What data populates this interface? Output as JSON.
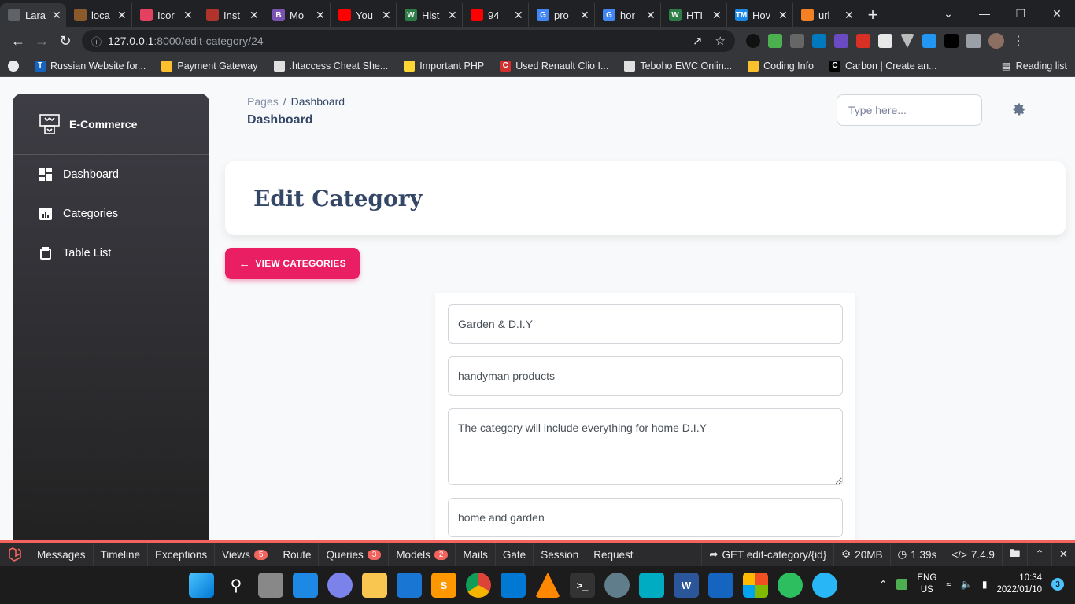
{
  "browser": {
    "tabs": [
      {
        "title": "Lara",
        "color": "#5f6368",
        "glyph": "",
        "active": true
      },
      {
        "title": "loca",
        "color": "#8b5a2b",
        "glyph": ""
      },
      {
        "title": "Icor",
        "color": "#e4405f",
        "glyph": ""
      },
      {
        "title": "Inst",
        "color": "#b0342b",
        "glyph": ""
      },
      {
        "title": "Mo",
        "color": "#7952b3",
        "glyph": "B"
      },
      {
        "title": "You",
        "color": "#ff0000",
        "glyph": ""
      },
      {
        "title": "Hist",
        "color": "#2d7d46",
        "glyph": "W"
      },
      {
        "title": "94",
        "color": "#ff0000",
        "glyph": ""
      },
      {
        "title": "pro",
        "color": "#4285f4",
        "glyph": "G"
      },
      {
        "title": "hor",
        "color": "#4285f4",
        "glyph": "G"
      },
      {
        "title": "HTI",
        "color": "#2d7d46",
        "glyph": "W"
      },
      {
        "title": "Hov",
        "color": "#1e88e5",
        "glyph": "TM"
      },
      {
        "title": "url",
        "color": "#f48024",
        "glyph": ""
      }
    ],
    "url_host": "127.0.0.1",
    "url_path": ":8000/edit-category/24",
    "bookmarks": [
      {
        "label": "Russian Website for...",
        "color": "#1565c0",
        "glyph": "T"
      },
      {
        "label": "Payment Gateway",
        "color": "#fbc02d",
        "glyph": ""
      },
      {
        "label": ".htaccess Cheat She...",
        "color": "#e0e0e0",
        "glyph": ""
      },
      {
        "label": "Important PHP",
        "color": "#fdd835",
        "glyph": ""
      },
      {
        "label": "Used Renault Clio I...",
        "color": "#d32f2f",
        "glyph": "C"
      },
      {
        "label": "Teboho EWC Onlin...",
        "color": "#e0e0e0",
        "glyph": ""
      },
      {
        "label": "Coding Info",
        "color": "#fbc02d",
        "glyph": ""
      },
      {
        "label": "Carbon | Create an...",
        "color": "#000000",
        "glyph": "C"
      }
    ],
    "reading_list": "Reading list"
  },
  "sidebar": {
    "brand": "E-Commerce",
    "items": [
      {
        "label": "Dashboard",
        "icon": "dashboard-icon"
      },
      {
        "label": "Categories",
        "icon": "chart-icon"
      },
      {
        "label": "Table List",
        "icon": "clipboard-icon"
      }
    ]
  },
  "header": {
    "breadcrumb_root": "Pages",
    "breadcrumb_sep": "/",
    "breadcrumb_current": "Dashboard",
    "page_title": "Dashboard",
    "search_placeholder": "Type here..."
  },
  "main": {
    "card_title": "Edit Category",
    "view_button": "VIEW CATEGORIES",
    "form": {
      "name": "Garden & D.I.Y",
      "subtitle": "handyman products",
      "description": "The category will include everything for home D.I.Y",
      "tags": "home and garden"
    }
  },
  "debugbar": {
    "items": [
      {
        "label": "Messages"
      },
      {
        "label": "Timeline"
      },
      {
        "label": "Exceptions"
      },
      {
        "label": "Views",
        "badge": "5"
      },
      {
        "label": "Route"
      },
      {
        "label": "Queries",
        "badge": "3"
      },
      {
        "label": "Models",
        "badge": "2"
      },
      {
        "label": "Mails"
      },
      {
        "label": "Gate"
      },
      {
        "label": "Session"
      },
      {
        "label": "Request"
      }
    ],
    "route": "GET edit-category/{id}",
    "memory": "20MB",
    "time": "1.39s",
    "php": "7.4.9"
  },
  "taskbar": {
    "lang_top": "ENG",
    "lang_bottom": "US",
    "time": "10:34",
    "date": "2022/01/10",
    "notifications": "3"
  },
  "colors": {
    "accent": "#e91e63",
    "debug_accent": "#f4645f"
  }
}
